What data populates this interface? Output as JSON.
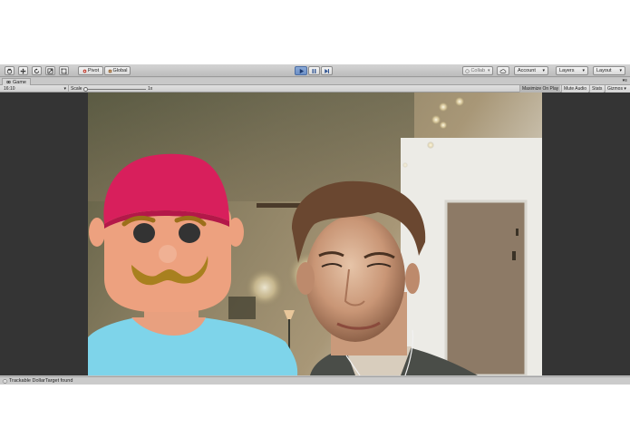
{
  "toolbar": {
    "tools": [
      {
        "name": "hand-tool",
        "icon": "hand-icon"
      },
      {
        "name": "move-tool",
        "icon": "move-arrows-icon"
      },
      {
        "name": "rotate-tool",
        "icon": "rotate-icon"
      },
      {
        "name": "scale-tool",
        "icon": "scale-icon"
      },
      {
        "name": "rect-tool",
        "icon": "rect-icon"
      }
    ],
    "pivot_label": "Pivot",
    "global_label": "Global",
    "play_controls": [
      "play",
      "pause",
      "step"
    ],
    "collab_label": "Collab",
    "account_label": "Account",
    "layers_label": "Layers",
    "layout_label": "Layout"
  },
  "tab": {
    "title": "Game"
  },
  "game_bar": {
    "aspect": "16:10",
    "scale_label": "Scale",
    "scale_value": "1x",
    "maximize_label": "Maximize On Play",
    "mute_label": "Mute Audio",
    "stats_label": "Stats",
    "gizmos_label": "Gizmos"
  },
  "status": {
    "message": "Trackable DollarTarget found"
  },
  "colors": {
    "accent": "#6c8fc6",
    "hat": "#d81f5c",
    "skin": "#eda17f",
    "shirt": "#7ed4ea",
    "mustache": "#a8801f"
  }
}
